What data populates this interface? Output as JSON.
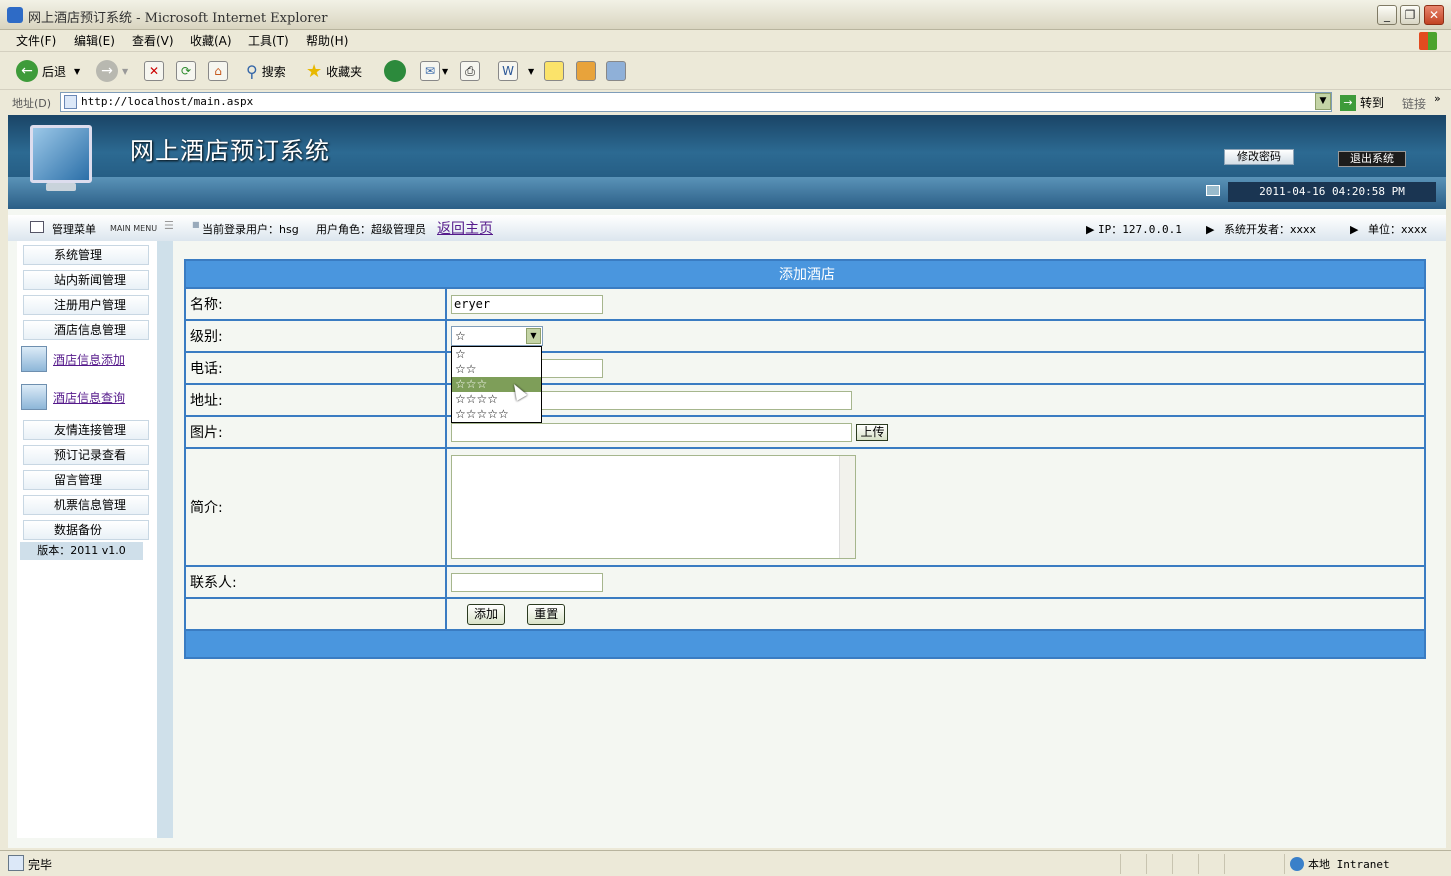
{
  "window": {
    "title": "网上酒店预订系统 - Microsoft Internet Explorer"
  },
  "menubar": [
    "文件(F)",
    "编辑(E)",
    "查看(V)",
    "收藏(A)",
    "工具(T)",
    "帮助(H)"
  ],
  "toolbar": {
    "back": "后退",
    "search": "搜索",
    "favorites": "收藏夹"
  },
  "address": {
    "label": "地址(D)",
    "url": "http://localhost/main.aspx",
    "go": "转到",
    "links": "链接"
  },
  "banner": {
    "title": "网上酒店预订系统",
    "change_password": "修改密码",
    "logout": "退出系统",
    "datetime": "2011-04-16 04:20:58 PM"
  },
  "infobar": {
    "menu_title": "管理菜单",
    "menu_sub": "MAIN MENU",
    "current_user": "当前登录用户：hsg",
    "role": "用户角色：超级管理员",
    "back_home": "返回主页",
    "ip": "IP：127.0.0.1",
    "developer": "系统开发者：xxxx",
    "unit": "单位：xxxx"
  },
  "sidebar": {
    "items": [
      "系统管理",
      "站内新闻管理",
      "注册用户管理",
      "酒店信息管理"
    ],
    "links": [
      "酒店信息添加",
      "酒店信息查询"
    ],
    "items2": [
      "友情连接管理",
      "预订记录查看",
      "留言管理",
      "机票信息管理",
      "数据备份"
    ],
    "version": "版本：2011 v1.0"
  },
  "form": {
    "header": "添加酒店",
    "name_label": "名称:",
    "name_value": "eryer",
    "level_label": "级别:",
    "level_value": "☆",
    "level_options": [
      "☆",
      "☆☆",
      "☆☆☆",
      "☆☆☆☆",
      "☆☆☆☆☆"
    ],
    "level_highlighted": "☆☆☆",
    "phone_label": "电话:",
    "address_label": "地址:",
    "image_label": "图片:",
    "upload": "上传",
    "intro_label": "简介:",
    "contact_label": "联系人:",
    "add": "添加",
    "reset": "重置"
  },
  "status": {
    "text": "完毕",
    "zone": "本地 Intranet"
  }
}
